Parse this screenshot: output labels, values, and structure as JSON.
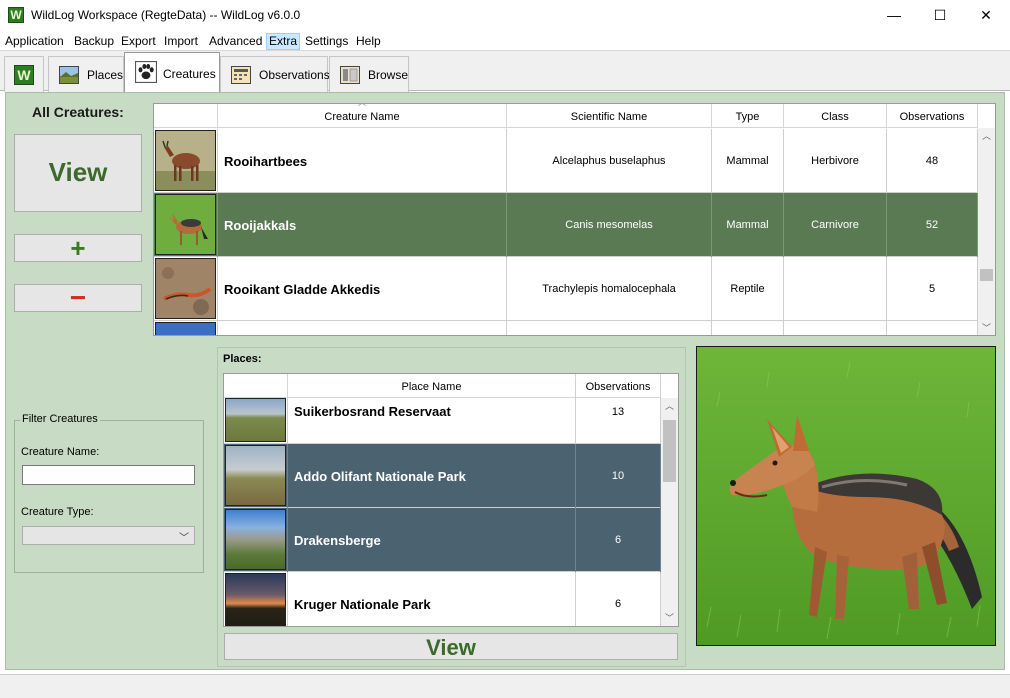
{
  "window": {
    "title": "WildLog Workspace (RegteData) -- WildLog v6.0.0",
    "app_icon": "W",
    "controls": {
      "minimize": "—",
      "maximize": "☐",
      "close": "✕"
    }
  },
  "menu": [
    "Application",
    "Backup",
    "Export",
    "Import",
    "Advanced",
    "Extra",
    "Settings",
    "Help"
  ],
  "tabs": {
    "home_icon": "W",
    "places": "Places",
    "creatures": "Creatures",
    "observations": "Observations",
    "browse": "Browse"
  },
  "left": {
    "title": "All Creatures:",
    "view_label": "View",
    "add_label": "+",
    "remove_label": "−"
  },
  "creatures_table": {
    "columns": [
      "Creature Name",
      "Scientific Name",
      "Type",
      "Class",
      "Observations"
    ],
    "rows": [
      {
        "name": "Rooihartbees",
        "scientific": "Alcelaphus buselaphus",
        "type": "Mammal",
        "class": "Herbivore",
        "observations": "48"
      },
      {
        "name": "Rooijakkals",
        "scientific": "Canis mesomelas",
        "type": "Mammal",
        "class": "Carnivore",
        "observations": "52"
      },
      {
        "name": "Rooikant Gladde Akkedis",
        "scientific": "Trachylepis homalocephala",
        "type": "Reptile",
        "class": "",
        "observations": "5"
      }
    ]
  },
  "filter": {
    "legend": "Filter Creatures",
    "name_label": "Creature Name:",
    "name_value": "",
    "type_label": "Creature Type:",
    "type_value": ""
  },
  "places": {
    "title": "Places:",
    "columns": [
      "Place Name",
      "Observations"
    ],
    "rows": [
      {
        "name": "Suikerbosrand Reservaat",
        "observations": "13"
      },
      {
        "name": "Addo Olifant Nationale Park",
        "observations": "10"
      },
      {
        "name": "Drakensberge",
        "observations": "6"
      },
      {
        "name": "Kruger Nationale Park",
        "observations": "6"
      }
    ],
    "view_label": "View"
  },
  "colors": {
    "panel_bg": "#c8dbc4",
    "selected_green": "#5a7a54",
    "selected_blue": "#4b6370",
    "view_text": "#3c6a2a"
  }
}
